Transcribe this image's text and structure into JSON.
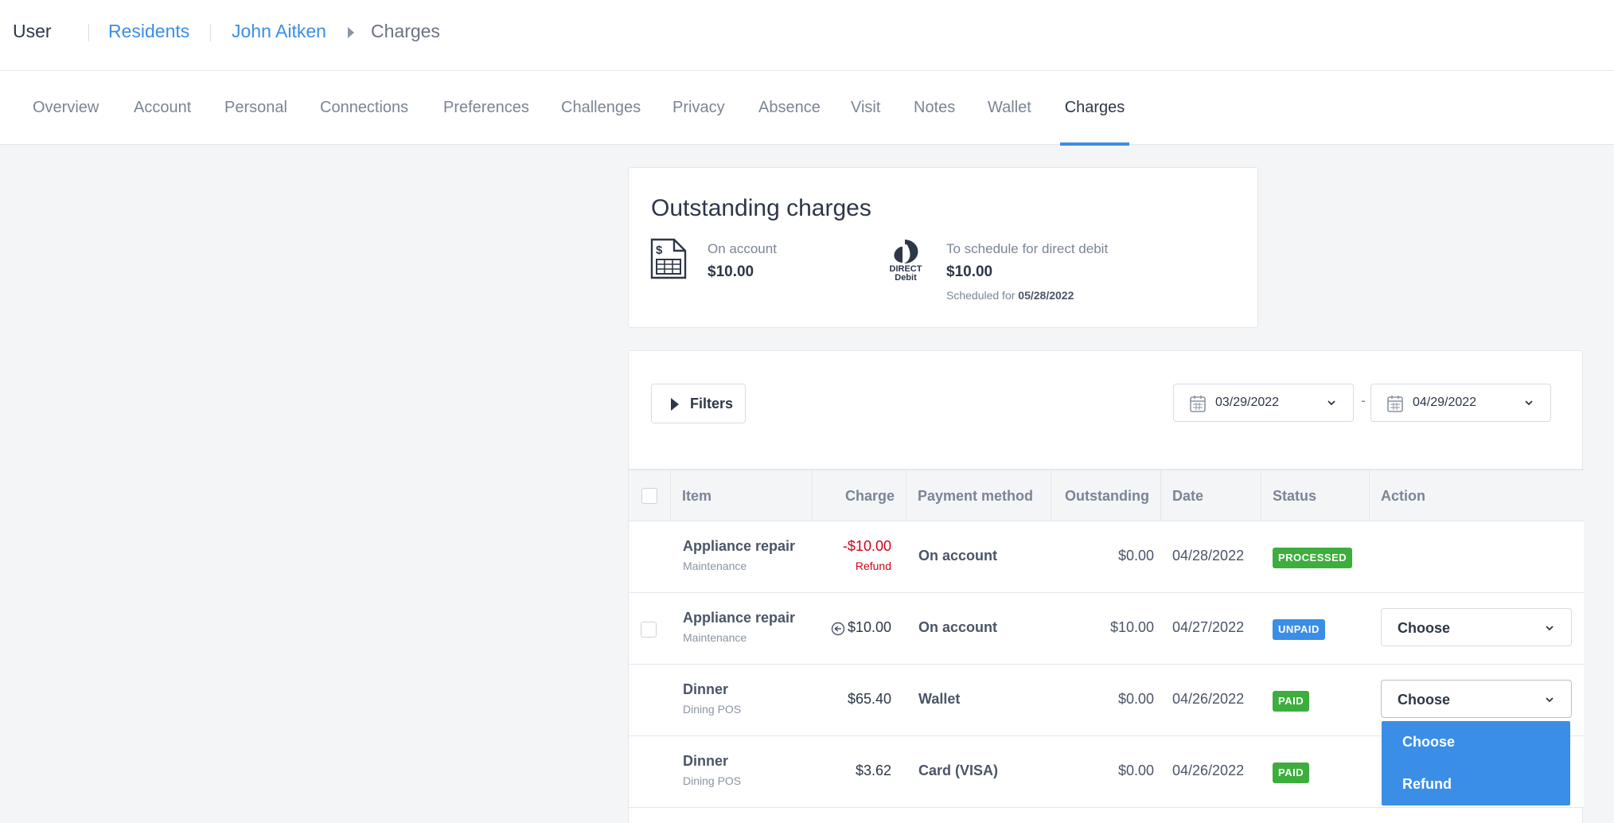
{
  "topbar": {
    "app_label": "User",
    "breadcrumb": [
      "Residents",
      "John Aitken"
    ],
    "current": "Charges"
  },
  "tabs": [
    {
      "label": "Overview"
    },
    {
      "label": "Account"
    },
    {
      "label": "Personal"
    },
    {
      "label": "Connections"
    },
    {
      "label": "Preferences"
    },
    {
      "label": "Challenges"
    },
    {
      "label": "Privacy"
    },
    {
      "label": "Absence"
    },
    {
      "label": "Visit"
    },
    {
      "label": "Notes"
    },
    {
      "label": "Wallet"
    },
    {
      "label": "Charges"
    }
  ],
  "active_tab": "Charges",
  "summary": {
    "title": "Outstanding charges",
    "on_account": {
      "label": "On account",
      "value": "$10.00"
    },
    "direct_debit": {
      "logo_text": "DIRECT Debit",
      "label": "To schedule for direct debit",
      "value": "$10.00",
      "scheduled_prefix": "Scheduled for",
      "scheduled_date": "05/28/2022"
    }
  },
  "filters": {
    "button_label": "Filters",
    "date_from": "03/29/2022",
    "date_separator": "-",
    "date_to": "04/29/2022"
  },
  "table": {
    "columns": [
      "Item",
      "Charge",
      "Payment method",
      "Outstanding",
      "Date",
      "Status",
      "Action"
    ],
    "rows": [
      {
        "item": "Appliance repair",
        "category": "Maintenance",
        "charge": "-$10.00",
        "charge_note": "Refund",
        "payment_method": "On account",
        "outstanding": "$0.00",
        "date": "04/28/2022",
        "status": "PROCESSED",
        "action": ""
      },
      {
        "item": "Appliance repair",
        "category": "Maintenance",
        "charge": "$10.00",
        "charge_note": "",
        "payment_method": "On account",
        "outstanding": "$10.00",
        "date": "04/27/2022",
        "status": "UNPAID",
        "action": "Choose"
      },
      {
        "item": "Dinner",
        "category": "Dining POS",
        "charge": "$65.40",
        "charge_note": "",
        "payment_method": "Wallet",
        "outstanding": "$0.00",
        "date": "04/26/2022",
        "status": "PAID",
        "action": "Choose"
      },
      {
        "item": "Dinner",
        "category": "Dining POS",
        "charge": "$3.62",
        "charge_note": "",
        "payment_method": "Card (VISA)",
        "outstanding": "$0.00",
        "date": "04/26/2022",
        "status": "PAID",
        "action": ""
      }
    ]
  },
  "action_dropdown": {
    "options": [
      "Choose",
      "Refund"
    ]
  },
  "colors": {
    "accent": "#3a8ee6",
    "paid": "#3dae3d",
    "negative": "#d0021b"
  }
}
